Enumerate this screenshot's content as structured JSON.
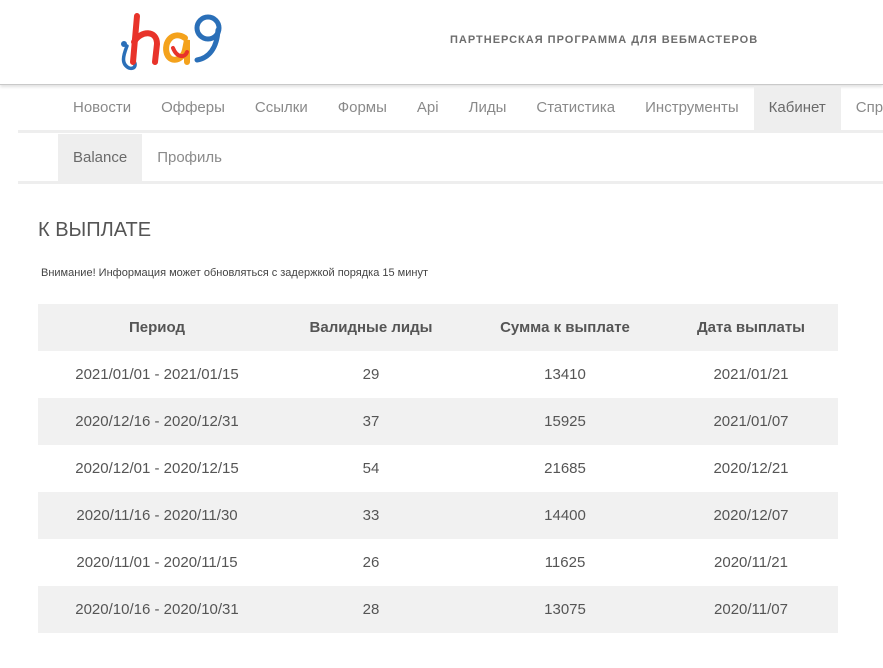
{
  "header": {
    "logo_text": "ha9",
    "tagline": "ПАРТНЕРСКАЯ ПРОГРАММА ДЛЯ ВЕБМАСТЕРОВ"
  },
  "nav": {
    "items": [
      {
        "label": "Новости"
      },
      {
        "label": "Офферы"
      },
      {
        "label": "Ссылки"
      },
      {
        "label": "Формы"
      },
      {
        "label": "Api"
      },
      {
        "label": "Лиды"
      },
      {
        "label": "Статистика"
      },
      {
        "label": "Инструменты"
      },
      {
        "label": "Кабинет"
      },
      {
        "label": "Спр"
      }
    ],
    "active": "Кабинет"
  },
  "subnav": {
    "items": [
      {
        "label": "Balance"
      },
      {
        "label": "Профиль"
      }
    ],
    "active": "Balance"
  },
  "main": {
    "title": "К ВЫПЛАТЕ",
    "notice": "Внимание! Информация может обновляться с задержкой порядка 15 минут",
    "table": {
      "headers": [
        "Период",
        "Валидные лиды",
        "Сумма к выплате",
        "Дата выплаты"
      ],
      "rows": [
        [
          "2021/01/01 - 2021/01/15",
          "29",
          "13410",
          "2021/01/21"
        ],
        [
          "2020/12/16 - 2020/12/31",
          "37",
          "15925",
          "2021/01/07"
        ],
        [
          "2020/12/01 - 2020/12/15",
          "54",
          "21685",
          "2020/12/21"
        ],
        [
          "2020/11/16 - 2020/11/30",
          "33",
          "14400",
          "2020/12/07"
        ],
        [
          "2020/11/01 - 2020/11/15",
          "26",
          "11625",
          "2020/11/21"
        ],
        [
          "2020/10/16 - 2020/10/31",
          "28",
          "13075",
          "2020/11/07"
        ]
      ]
    }
  },
  "colors": {
    "logo_blue": "#2a6fb8",
    "logo_red": "#e8332a",
    "logo_orange": "#f4a21c",
    "active_tab_bg": "#eeeeee",
    "stripe_bg": "#f1f1f1"
  }
}
